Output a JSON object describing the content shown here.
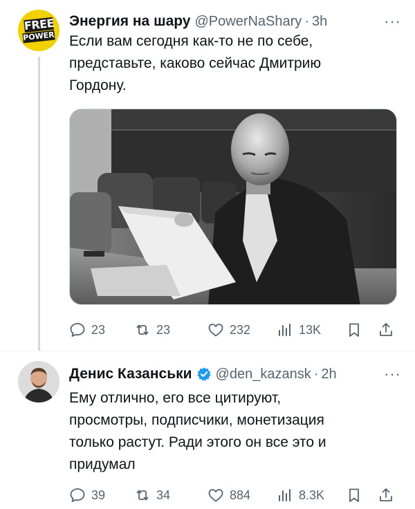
{
  "tweets": [
    {
      "author_name": "Энергия на шару",
      "handle": "@PowerNaShary",
      "dot": "·",
      "time": "3h",
      "avatar_logo": {
        "line1": "FREE",
        "line2": "POWER"
      },
      "text_lines": [
        "Если вам сегодня как-то не по себе,",
        "представьте, каково сейчас Дмитрию",
        "Гордону."
      ],
      "actions": {
        "replies": "23",
        "retweets": "23",
        "likes": "232",
        "views": "13K"
      }
    },
    {
      "author_name": "Денис Казанськи",
      "handle": "@den_kazansk",
      "dot": "·",
      "time": "2h",
      "verified": true,
      "text_lines": [
        "Ему отлично, его все цитируют,",
        "просмотры, подписчики, монетизация",
        "только растут. Ради этого он все это и",
        "придумал"
      ],
      "actions": {
        "replies": "39",
        "retweets": "34",
        "likes": "884",
        "views": "8.3K"
      }
    }
  ],
  "more_label": "···",
  "colors": {
    "text": "#0f1419",
    "secondary": "#536471",
    "verified": "#1d9bf0",
    "avatar_yellow": "#f2d100"
  }
}
